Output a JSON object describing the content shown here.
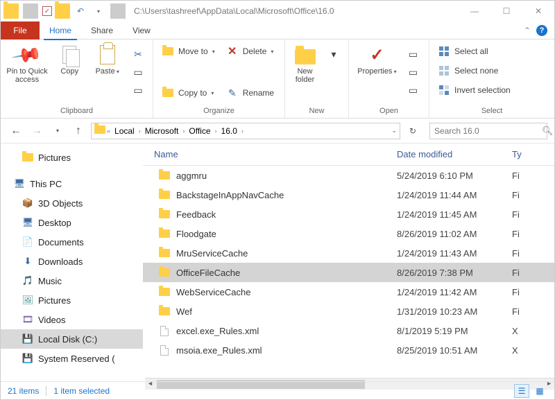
{
  "title_path": "C:\\Users\\tashreef\\AppData\\Local\\Microsoft\\Office\\16.0",
  "tabs": {
    "file": "File",
    "home": "Home",
    "share": "Share",
    "view": "View"
  },
  "ribbon": {
    "pin": "Pin to Quick access",
    "copy": "Copy",
    "paste": "Paste",
    "clipboard_label": "Clipboard",
    "moveto": "Move to",
    "copyto": "Copy to",
    "delete": "Delete",
    "rename": "Rename",
    "organize_label": "Organize",
    "newfolder": "New folder",
    "new_label": "New",
    "properties": "Properties",
    "open_label": "Open",
    "select_all": "Select all",
    "select_none": "Select none",
    "invert": "Invert selection",
    "select_label": "Select"
  },
  "breadcrumbs": [
    "Local",
    "Microsoft",
    "Office",
    "16.0"
  ],
  "search_placeholder": "Search 16.0",
  "nav": {
    "pictures_qa": "Pictures",
    "thispc": "This PC",
    "items": [
      "3D Objects",
      "Desktop",
      "Documents",
      "Downloads",
      "Music",
      "Pictures",
      "Videos",
      "Local Disk (C:)",
      "System Reserved ("
    ]
  },
  "columns": {
    "name": "Name",
    "date": "Date modified",
    "type": "Ty"
  },
  "files": [
    {
      "name": "aggmru",
      "date": "5/24/2019 6:10 PM",
      "type": "Fi",
      "kind": "folder"
    },
    {
      "name": "BackstageInAppNavCache",
      "date": "1/24/2019 11:44 AM",
      "type": "Fi",
      "kind": "folder"
    },
    {
      "name": "Feedback",
      "date": "1/24/2019 11:45 AM",
      "type": "Fi",
      "kind": "folder"
    },
    {
      "name": "Floodgate",
      "date": "8/26/2019 11:02 AM",
      "type": "Fi",
      "kind": "folder"
    },
    {
      "name": "MruServiceCache",
      "date": "1/24/2019 11:43 AM",
      "type": "Fi",
      "kind": "folder"
    },
    {
      "name": "OfficeFileCache",
      "date": "8/26/2019 7:38 PM",
      "type": "Fi",
      "kind": "folder",
      "selected": true
    },
    {
      "name": "WebServiceCache",
      "date": "1/24/2019 11:42 AM",
      "type": "Fi",
      "kind": "folder"
    },
    {
      "name": "Wef",
      "date": "1/31/2019 10:23 AM",
      "type": "Fi",
      "kind": "folder"
    },
    {
      "name": "excel.exe_Rules.xml",
      "date": "8/1/2019 5:19 PM",
      "type": "X",
      "kind": "file"
    },
    {
      "name": "msoia.exe_Rules.xml",
      "date": "8/25/2019 10:51 AM",
      "type": "X",
      "kind": "file"
    }
  ],
  "status": {
    "count": "21 items",
    "selected": "1 item selected"
  }
}
